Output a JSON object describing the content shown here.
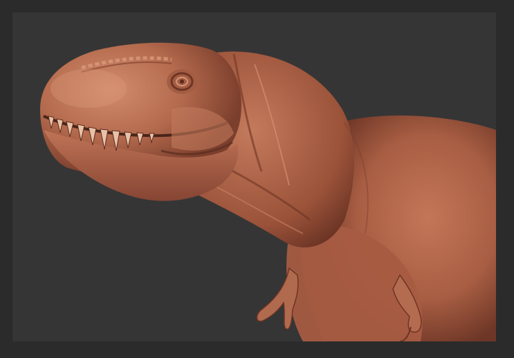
{
  "scene": {
    "subject_icon": "t-rex-sculpt-icon",
    "colors": {
      "background_outer": "#2b2b2b",
      "background_viewport": "#353535",
      "clay_base": "#b86a4e",
      "clay_light": "#d08a6c",
      "clay_dark": "#7a3e2c",
      "clay_shadow": "#4a2419",
      "teeth": "#e0b8a0"
    }
  }
}
